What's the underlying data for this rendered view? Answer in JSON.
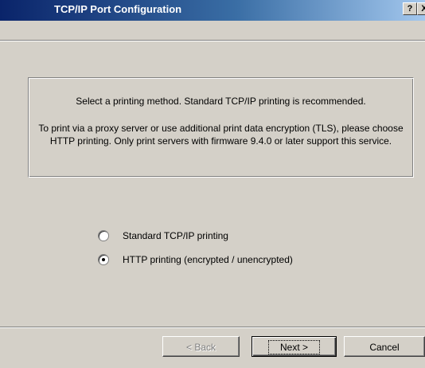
{
  "window": {
    "title": "TCP/IP Port Configuration",
    "help_glyph": "?",
    "close_glyph": "X"
  },
  "info": {
    "line1": "Select a printing method. Standard TCP/IP printing is recommended.",
    "line2": "To print via a proxy server or use additional print data encryption (TLS), please choose HTTP printing. Only print servers with firmware 9.4.0 or later support this service."
  },
  "options": [
    {
      "label": "Standard TCP/IP printing",
      "selected": false
    },
    {
      "label": "HTTP printing (encrypted / unencrypted)",
      "selected": true
    }
  ],
  "buttons": {
    "back": "< Back",
    "next": "Next >",
    "cancel": "Cancel"
  },
  "colors": {
    "title_bar_start": "#0a246a",
    "title_bar_end": "#a6caf0",
    "face": "#d4d0c8"
  }
}
